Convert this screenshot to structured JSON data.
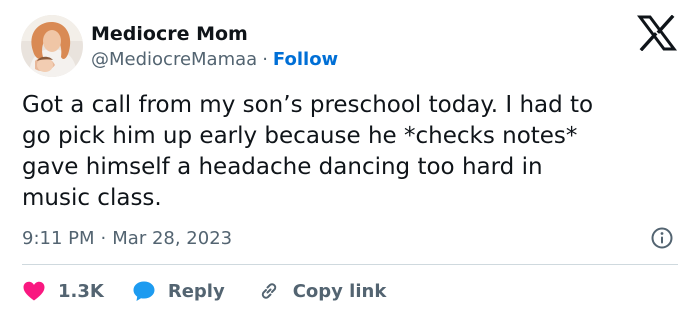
{
  "user": {
    "display_name": "Mediocre Mom",
    "handle": "@MediocreMamaa",
    "separator": "·",
    "follow_label": "Follow"
  },
  "tweet": {
    "text": "Got a call from my son’s preschool today. I had to\ngo pick him up early because he *checks notes*\ngave himself a headache dancing too hard in\nmusic class.",
    "time": "9:11 PM",
    "separator": "·",
    "date": "Mar 28, 2023"
  },
  "actions": {
    "like_count": "1.3K",
    "reply_label": "Reply",
    "copy_link_label": "Copy link"
  },
  "icons": {
    "brand": "x-logo-icon",
    "info": "info-icon",
    "like": "heart-icon",
    "reply": "speech-bubble-icon",
    "copy_link": "link-icon"
  },
  "colors": {
    "text": "#0f1419",
    "secondary": "#536471",
    "follow": "#006fd6",
    "like": "#f91880",
    "reply": "#1d9bf0",
    "divider": "#cfd9de"
  }
}
